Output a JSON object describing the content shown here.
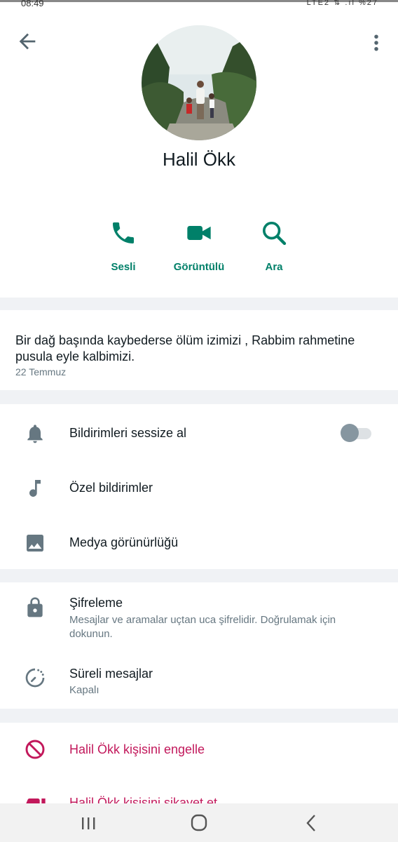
{
  "status_bar": {
    "time": "08:49",
    "indicators": "LTE2 ⇅ .ıl %27"
  },
  "header": {
    "back_icon": "arrow-left-icon",
    "more_icon": "more-vertical-icon",
    "contact_name": "Halil Ökk"
  },
  "actions": [
    {
      "label": "Sesli",
      "icon": "phone-icon"
    },
    {
      "label": "Görüntülü",
      "icon": "video-camera-icon"
    },
    {
      "label": "Ara",
      "icon": "search-icon"
    }
  ],
  "about": {
    "text": "Bir dağ başında kaybederse ölüm izimizi , Rabbim rahmetine pusula eyle kalbimizi.",
    "date": "22 Temmuz"
  },
  "settings": {
    "mute": {
      "label": "Bildirimleri sessize al",
      "icon": "bell-icon",
      "enabled": false
    },
    "custom_notifications": {
      "label": "Özel bildirimler",
      "icon": "music-note-icon"
    },
    "media_visibility": {
      "label": "Medya görünürlüğü",
      "icon": "image-icon"
    }
  },
  "security": {
    "encryption": {
      "title": "Şifreleme",
      "subtitle": "Mesajlar ve aramalar uçtan uca şifrelidir. Doğrulamak için dokunun.",
      "icon": "lock-icon"
    },
    "disappearing": {
      "title": "Süreli mesajlar",
      "subtitle": "Kapalı",
      "icon": "timer-icon"
    }
  },
  "danger": {
    "block": {
      "label": "Halil Ökk kişisini engelle",
      "icon": "block-icon"
    },
    "report": {
      "label": "Halil Ökk kişisini şikayet et",
      "icon": "thumbs-down-icon"
    }
  },
  "colors": {
    "accent": "#008069",
    "danger": "#c2185b",
    "secondary": "#667781"
  },
  "navbar": {
    "recents_icon": "recents-icon",
    "home_icon": "home-icon",
    "back_icon": "nav-back-icon"
  }
}
